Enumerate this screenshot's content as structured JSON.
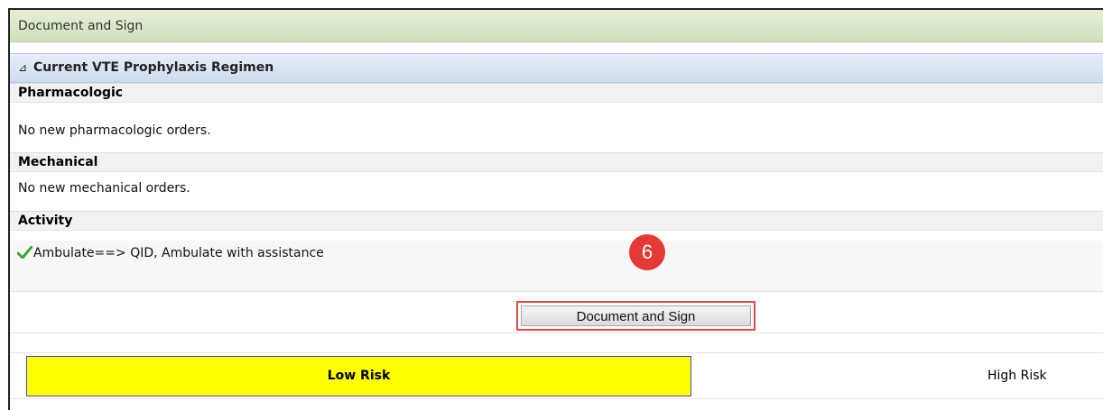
{
  "window": {
    "title": "Document and Sign"
  },
  "section": {
    "collapse_glyph": "⊿",
    "title": "Current VTE Prophylaxis Regimen"
  },
  "pharmacologic": {
    "heading": "Pharmacologic",
    "text": "No new pharmacologic orders."
  },
  "mechanical": {
    "heading": "Mechanical",
    "text": "No new mechanical orders."
  },
  "activity": {
    "heading": "Activity",
    "order_text": "Ambulate==> QID, Ambulate with assistance",
    "check_color": "#3aa832"
  },
  "callout": {
    "step_number": "6",
    "color": "#e53935"
  },
  "actions": {
    "document_sign_label": "Document and Sign",
    "highlight_color": "#e34b4b"
  },
  "risk": {
    "low_label": "Low Risk",
    "high_label": "High Risk",
    "selected_color": "#ffff00"
  }
}
